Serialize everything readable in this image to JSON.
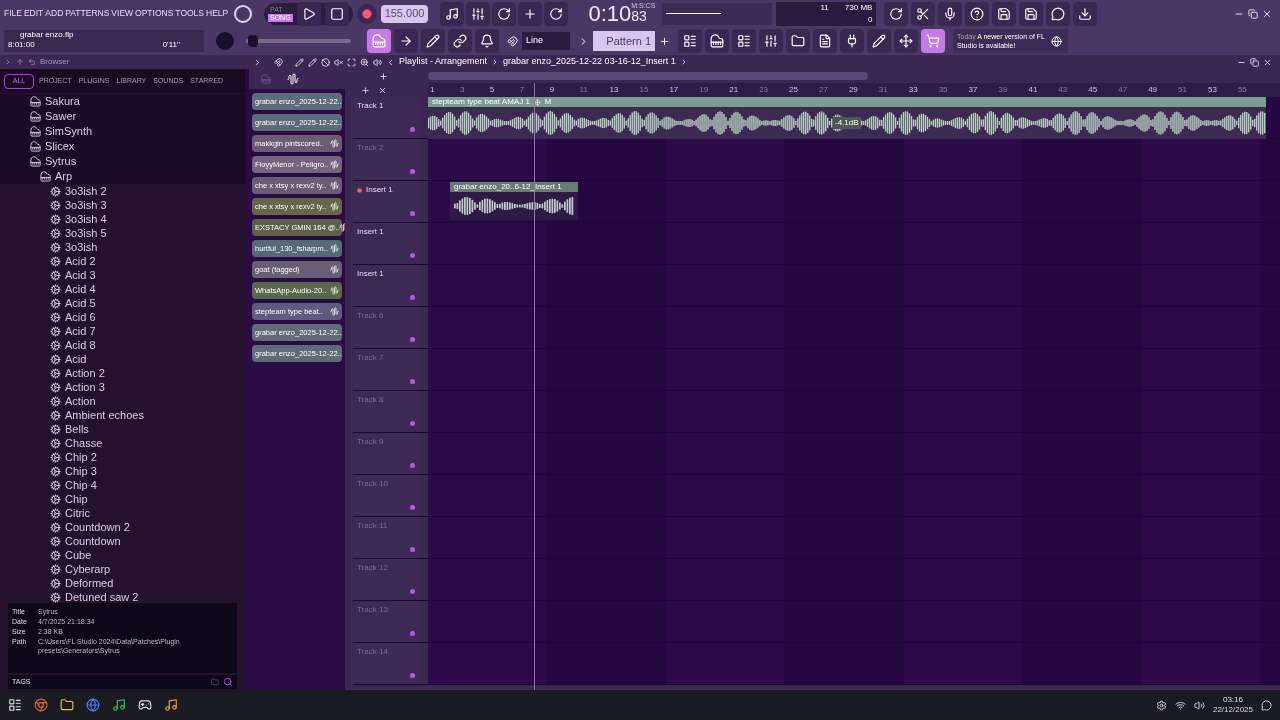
{
  "menu": [
    "FILE",
    "EDIT",
    "ADD",
    "PATTERNS",
    "VIEW",
    "OPTIONS",
    "TOOLS",
    "HELP"
  ],
  "transport": {
    "pat": "PAT",
    "song": "SONG",
    "song_selected": true,
    "tempo": "155.000",
    "time": "0:10",
    "time_cs": "83",
    "time_unit": "M:S:CS",
    "cpu": "11",
    "memory": "730 MB",
    "poly": "0"
  },
  "project": {
    "file": "grabar enzo.flp",
    "position": "8:01:00",
    "length": "0'11''"
  },
  "pitch": {
    "level": 0.05
  },
  "snap": "Line",
  "pattern": "Pattern 1",
  "news": {
    "when": "Today",
    "text": "A newer version of FL Studio is available!"
  },
  "browser": {
    "title": "Browser",
    "tabs": [
      {
        "label": "ALL",
        "selected": true
      },
      {
        "label": "PROJECT",
        "selected": false
      },
      {
        "label": "PLUGINS",
        "selected": false
      },
      {
        "label": "LIBRARY",
        "selected": false
      },
      {
        "label": "SOUNDS",
        "selected": false
      },
      {
        "label": "STARRED",
        "selected": false
      }
    ],
    "tree": [
      {
        "label": "Sakura",
        "kind": "plugin"
      },
      {
        "label": "Sawer",
        "kind": "plugin"
      },
      {
        "label": "SimSynth",
        "kind": "plugin"
      },
      {
        "label": "Slicex",
        "kind": "plugin"
      },
      {
        "label": "Sytrus",
        "kind": "plugin",
        "children": [
          {
            "label": "Arp",
            "kind": "plugin",
            "children": [
              {
                "label": "3o3ish 2",
                "kind": "preset"
              },
              {
                "label": "3o3ish 3",
                "kind": "preset"
              },
              {
                "label": "3o3ish 4",
                "kind": "preset"
              },
              {
                "label": "3o3ish 5",
                "kind": "preset"
              },
              {
                "label": "3o3ish",
                "kind": "preset"
              },
              {
                "label": "Acid 2",
                "kind": "preset"
              },
              {
                "label": "Acid 3",
                "kind": "preset"
              },
              {
                "label": "Acid 4",
                "kind": "preset"
              },
              {
                "label": "Acid 5",
                "kind": "preset"
              },
              {
                "label": "Acid 6",
                "kind": "preset"
              },
              {
                "label": "Acid 7",
                "kind": "preset"
              },
              {
                "label": "Acid 8",
                "kind": "preset"
              },
              {
                "label": "Acid",
                "kind": "preset"
              },
              {
                "label": "Action 2",
                "kind": "preset"
              },
              {
                "label": "Action 3",
                "kind": "preset"
              },
              {
                "label": "Action",
                "kind": "preset"
              },
              {
                "label": "Ambient echoes",
                "kind": "preset"
              },
              {
                "label": "Bells",
                "kind": "preset"
              },
              {
                "label": "Chasse",
                "kind": "preset"
              },
              {
                "label": "Chip 2",
                "kind": "preset"
              },
              {
                "label": "Chip 3",
                "kind": "preset"
              },
              {
                "label": "Chip 4",
                "kind": "preset"
              },
              {
                "label": "Chip",
                "kind": "preset"
              },
              {
                "label": "Citric",
                "kind": "preset"
              },
              {
                "label": "Countdown 2",
                "kind": "preset"
              },
              {
                "label": "Countdown",
                "kind": "preset"
              },
              {
                "label": "Cube",
                "kind": "preset"
              },
              {
                "label": "Cyberarp",
                "kind": "preset"
              },
              {
                "label": "Deformed",
                "kind": "preset"
              },
              {
                "label": "Detuned saw 2",
                "kind": "preset"
              }
            ]
          }
        ]
      }
    ],
    "info": [
      {
        "label": "Title",
        "value": "Sytrus"
      },
      {
        "label": "Date",
        "value": "4/7/2025 21:18:34"
      },
      {
        "label": "Size",
        "value": "2.38 KB"
      },
      {
        "label": "Path",
        "value": "C:\\Users\\FL Studio 2024\\Data\\Patches\\Plugin presets\\Generators\\Sytrus"
      }
    ],
    "tags": "TAGS"
  },
  "playlist": {
    "title": "Playlist - Arrangement",
    "crumb": "grabar enzo_2025-12-22 03-16-12_Insert 1",
    "clips": [
      {
        "label": "grabar enzo_2025-12-22..",
        "kind": "pattern",
        "color": "#5f6b78"
      },
      {
        "label": "grabar enzo_2025-12-22..",
        "kind": "pattern",
        "color": "#5f6b78"
      },
      {
        "label": "makkgin pintscored..",
        "kind": "audio",
        "color": "#6c5a78"
      },
      {
        "label": "FloyyMenor - Peligro..",
        "kind": "audio",
        "color": "#75647e"
      },
      {
        "label": "che x xtsy x rexv2 ty..",
        "kind": "audio",
        "color": "#6a5b76"
      },
      {
        "label": "che x xtsy x rexv2 ty..",
        "kind": "audio",
        "color": "#66654a"
      },
      {
        "label": "EXSTACY GMIN 164 @..",
        "kind": "audio",
        "color": "#5e6048"
      },
      {
        "label": "hurtful_130_fsharpm..",
        "kind": "audio",
        "color": "#546b74"
      },
      {
        "label": "goat (tagged)",
        "kind": "audio",
        "color": "#685f74"
      },
      {
        "label": "WhatsApp-Audio-20..",
        "kind": "audio",
        "color": "#586a4a"
      },
      {
        "label": "stepteam type beat..",
        "kind": "audio",
        "color": "#5f5a80"
      },
      {
        "label": "grabar enzo_2025-12-22..",
        "kind": "pattern",
        "color": "#5f6b78"
      },
      {
        "label": "grabar enzo_2025-12-22..",
        "kind": "pattern",
        "color": "#5f6b78"
      }
    ],
    "ruler": [
      "1",
      "3",
      "5",
      "7",
      "9",
      "11",
      "13",
      "15",
      "17",
      "19",
      "21",
      "23",
      "25",
      "27",
      "29",
      "31",
      "33",
      "35",
      "37",
      "39",
      "41",
      "43",
      "45",
      "47",
      "49",
      "51",
      "53",
      "55"
    ],
    "tracks": [
      {
        "name": "Track 1",
        "dimmed": false,
        "clip": {
          "kind": "full",
          "label": "stepteam type beat AMAJ 1",
          "tail": "M",
          "gain": "-4.1dB"
        }
      },
      {
        "name": "Track 2",
        "dimmed": true
      },
      {
        "name": "Insert 1",
        "dimmed": false,
        "kind": "insert",
        "clip": {
          "kind": "short",
          "label": "grabar enzo_20..6-12_Insert 1"
        }
      },
      {
        "name": "Insert 1",
        "dimmed": false
      },
      {
        "name": "Insert 1",
        "dimmed": false
      },
      {
        "name": "Track 6",
        "dimmed": true
      },
      {
        "name": "Track 7",
        "dimmed": true
      },
      {
        "name": "Track 8",
        "dimmed": true
      },
      {
        "name": "Track 9",
        "dimmed": true
      },
      {
        "name": "Track 10",
        "dimmed": true
      },
      {
        "name": "Track 11",
        "dimmed": true
      },
      {
        "name": "Track 12",
        "dimmed": true
      },
      {
        "name": "Track 13",
        "dimmed": true
      },
      {
        "name": "Track 14",
        "dimmed": true
      }
    ]
  },
  "clock": {
    "time": "03:16",
    "date": "22/12/2025"
  }
}
